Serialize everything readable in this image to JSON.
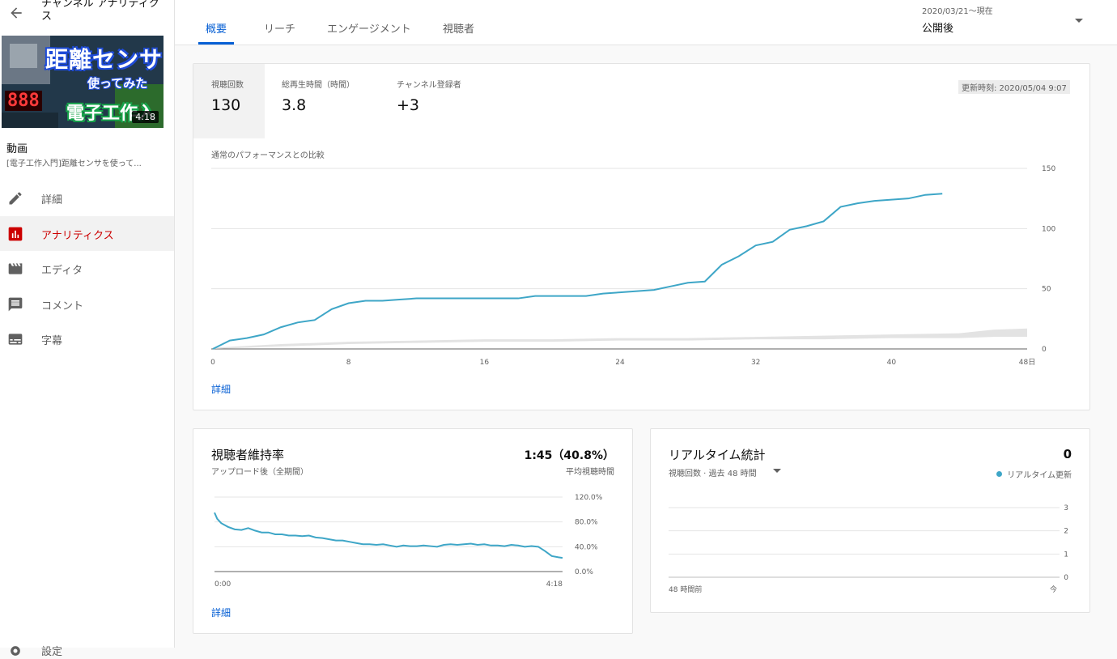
{
  "sidebar": {
    "channel_title": "チャンネル アナリティクス",
    "thumbnail": {
      "text_main": "距離センサ",
      "text_sub": "使ってみた",
      "text_series": "電子工作入門",
      "led_digits": "888",
      "duration": "4:18"
    },
    "video_label": "動画",
    "video_title": "[電子工作入門]距離センサを使って...",
    "items": [
      {
        "label": "詳細",
        "icon": "pencil-icon"
      },
      {
        "label": "アナリティクス",
        "icon": "analytics-icon"
      },
      {
        "label": "エディタ",
        "icon": "film-icon"
      },
      {
        "label": "コメント",
        "icon": "comment-icon"
      },
      {
        "label": "字幕",
        "icon": "subtitles-icon"
      }
    ],
    "settings_label": "設定"
  },
  "tabs": [
    {
      "label": "概要"
    },
    {
      "label": "リーチ"
    },
    {
      "label": "エンゲージメント"
    },
    {
      "label": "視聴者"
    }
  ],
  "date": {
    "range": "2020/03/21〜現在",
    "selected": "公開後"
  },
  "overview": {
    "metrics": [
      {
        "label": "視聴回数",
        "value": "130"
      },
      {
        "label": "総再生時間（時間）",
        "value": "3.8"
      },
      {
        "label": "チャンネル登録者",
        "value": "+3"
      }
    ],
    "updated": "更新時刻: 2020/05/04 9:07",
    "comparison_label": "通常のパフォーマンスとの比較",
    "more_link": "詳細"
  },
  "colors": {
    "accent_blue": "#065fd4",
    "line_blue": "#3ea6c7",
    "active_red": "#cc0000"
  },
  "chart_data": [
    {
      "type": "line",
      "x_ticks": [
        "0",
        "8",
        "16",
        "24",
        "32",
        "40",
        "48日"
      ],
      "y_ticks": [
        "0",
        "50",
        "100",
        "150"
      ],
      "xlim": [
        0,
        48
      ],
      "ylim": [
        0,
        150
      ],
      "grid": true,
      "series": [
        {
          "x": [
            0,
            1,
            2,
            3,
            4,
            5,
            6,
            7,
            8,
            9,
            10,
            11,
            12,
            13,
            14,
            15,
            16,
            17,
            18,
            19,
            20,
            21,
            22,
            23,
            24,
            25,
            26,
            27,
            28,
            29,
            30,
            31,
            32,
            33,
            34,
            35,
            36,
            37,
            38,
            39,
            40,
            41,
            42,
            43
          ],
          "values": [
            0,
            7,
            9,
            12,
            18,
            22,
            24,
            33,
            38,
            40,
            40,
            41,
            42,
            42,
            42,
            42,
            42,
            42,
            42,
            44,
            44,
            44,
            44,
            46,
            47,
            48,
            49,
            52,
            55,
            56,
            70,
            77,
            86,
            89,
            99,
            102,
            106,
            118,
            121,
            123,
            124,
            125,
            128,
            129
          ]
        }
      ],
      "band": {
        "x": [
          0,
          4,
          8,
          12,
          16,
          20,
          24,
          28,
          32,
          36,
          40,
          44,
          46,
          48
        ],
        "low": [
          0,
          2,
          4,
          5,
          6,
          6,
          7,
          7,
          8,
          8,
          9,
          9,
          10,
          10
        ],
        "high": [
          1,
          4,
          6,
          7,
          8,
          8,
          9,
          9,
          10,
          11,
          12,
          13,
          16,
          17
        ]
      }
    },
    {
      "type": "line",
      "title": "視聴者維持率",
      "subtitle": "アップロード後（全期間）",
      "headline_value": "1:45（40.8%）",
      "headline_label": "平均視聴時間",
      "x_ticks": [
        "0:00",
        "4:18"
      ],
      "y_ticks": [
        "0.0%",
        "40.0%",
        "80.0%",
        "120.0%"
      ],
      "xlim": [
        0,
        258
      ],
      "ylim": [
        0,
        120
      ],
      "series": [
        {
          "x": [
            0,
            2,
            5,
            10,
            15,
            20,
            25,
            30,
            35,
            40,
            45,
            50,
            55,
            60,
            65,
            70,
            75,
            80,
            85,
            90,
            95,
            100,
            105,
            110,
            115,
            120,
            125,
            130,
            135,
            140,
            145,
            150,
            155,
            160,
            165,
            170,
            175,
            180,
            185,
            190,
            195,
            200,
            205,
            210,
            215,
            220,
            225,
            230,
            235,
            240,
            245,
            250,
            255,
            258
          ],
          "values": [
            95,
            85,
            78,
            72,
            68,
            67,
            70,
            66,
            63,
            63,
            60,
            60,
            58,
            58,
            57,
            58,
            55,
            54,
            52,
            50,
            50,
            48,
            46,
            44,
            44,
            43,
            44,
            42,
            40,
            42,
            41,
            41,
            42,
            41,
            40,
            43,
            44,
            43,
            44,
            45,
            43,
            44,
            42,
            42,
            41,
            43,
            42,
            40,
            41,
            40,
            33,
            25,
            23,
            22
          ]
        }
      ],
      "more_link": "詳細"
    },
    {
      "type": "line",
      "title": "リアルタイム統計",
      "headline_value": "0",
      "subtitle": "視聴回数 · 過去 48 時間",
      "legend": "リアルタイム更新",
      "x_ticks": [
        "48 時間前",
        "今"
      ],
      "y_ticks": [
        "0",
        "1",
        "2",
        "3"
      ],
      "ylim": [
        0,
        3
      ],
      "series": [
        {
          "values": [
            0,
            0,
            0,
            0,
            0,
            0,
            0,
            0
          ]
        }
      ]
    }
  ]
}
